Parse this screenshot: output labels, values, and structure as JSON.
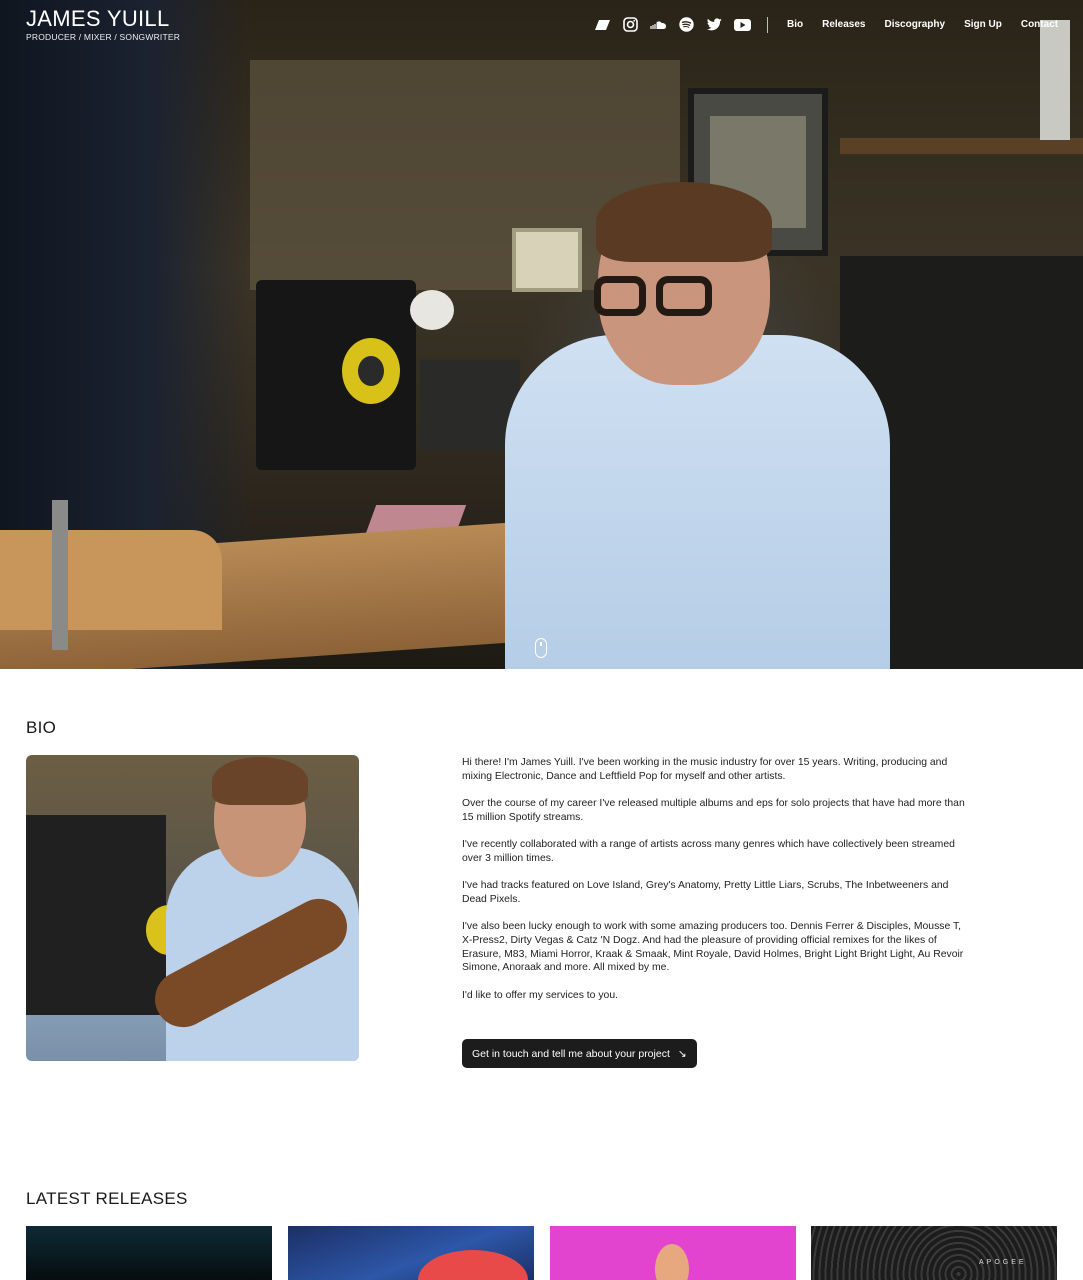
{
  "header": {
    "brand_name": "JAMES YUILL",
    "brand_tagline": "PRODUCER / MIXER / SONGWRITER",
    "social_icons": [
      "bandcamp-icon",
      "instagram-icon",
      "soundcloud-icon",
      "spotify-icon",
      "twitter-icon",
      "youtube-icon"
    ],
    "nav": [
      "Bio",
      "Releases",
      "Discography",
      "Sign Up",
      "Contact"
    ]
  },
  "bio": {
    "title": "BIO",
    "paragraphs": [
      "Hi there! I'm James Yuill. I've been working in the music industry for over 15 years. Writing, producing and mixing Electronic, Dance and Leftfield Pop for myself and other artists.",
      "Over the course of my career I've released multiple albums and eps for solo projects that have had more than 15 million Spotify streams.",
      "I've recently collaborated with a range of artists across many genres which have collectively been streamed over 3 million times.",
      "I've had tracks featured on Love Island, Grey's Anatomy, Pretty Little Liars, Scrubs, The Inbetweeners and Dead Pixels.",
      "I've also been lucky enough to work with some amazing producers too. Dennis Ferrer & Disciples, Mousse T, X-Press2, Dirty Vegas & Catz 'N Dogz. And had the pleasure of providing official remixes for the likes of Erasure, M83, Miami Horror, Kraak & Smaak, Mint Royale, David Holmes, Bright Light Bright Light, Au Revoir Simone, Anoraak and more. All mixed by me.",
      "I'd like to offer my services to you."
    ],
    "cta_label": "Get in touch and tell me about your project",
    "cta_arrow": "↘"
  },
  "releases": {
    "title": "LATEST RELEASES",
    "card_4_label": "APOGEE"
  },
  "colors": {
    "text": "#1a1a1a",
    "button_bg": "#1c1c1c",
    "header_text": "#ffffff"
  }
}
